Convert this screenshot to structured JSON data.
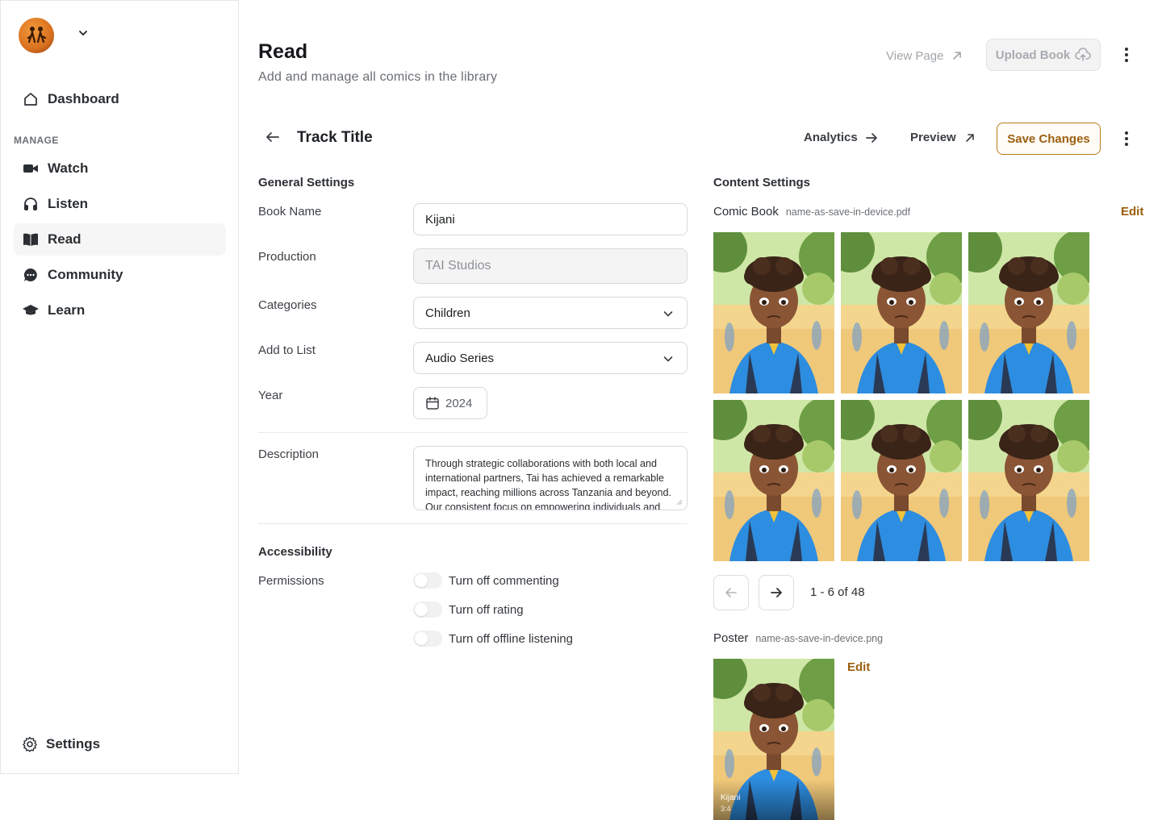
{
  "sidebar": {
    "manage_label": "MANAGE",
    "dashboard": {
      "label": "Dashboard",
      "icon": "home-icon"
    },
    "items": [
      {
        "label": "Watch",
        "icon": "video-camera-icon"
      },
      {
        "label": "Listen",
        "icon": "headphones-icon"
      },
      {
        "label": "Read",
        "icon": "book-open-icon",
        "active": true
      },
      {
        "label": "Community",
        "icon": "chat-bubble-icon"
      },
      {
        "label": "Learn",
        "icon": "graduation-cap-icon"
      }
    ],
    "settings": {
      "label": "Settings",
      "icon": "gear-icon"
    }
  },
  "header": {
    "title": "Read",
    "subtitle": "Add and manage all comics in the library",
    "view_page": "View Page",
    "upload_book": "Upload Book"
  },
  "subheader": {
    "title": "Track Title",
    "analytics": "Analytics",
    "preview": "Preview",
    "save": "Save Changes"
  },
  "general": {
    "section_title": "General Settings",
    "book_name": {
      "label": "Book Name",
      "value": "Kijani"
    },
    "production": {
      "label": "Production",
      "value": "TAI Studios"
    },
    "categories": {
      "label": "Categories",
      "value": "Children"
    },
    "add_to_list": {
      "label": "Add to List",
      "value": "Audio Series"
    },
    "year": {
      "label": "Year",
      "value": "2024"
    },
    "description": {
      "label": "Description",
      "value": "Through strategic collaborations with both local and international partners, Tai has achieved a remarkable impact, reaching millions across Tanzania and beyond. Our consistent focus on empowering individuals and"
    }
  },
  "accessibility": {
    "section_title": "Accessibility",
    "permissions_label": "Permissions",
    "toggles": [
      {
        "label": "Turn off commenting",
        "on": false
      },
      {
        "label": "Turn off rating",
        "on": false
      },
      {
        "label": "Turn off offline listening",
        "on": false
      }
    ]
  },
  "content": {
    "section_title": "Content Settings",
    "comic_book": {
      "label": "Comic Book",
      "filename": "name-as-save-in-device.pdf",
      "edit": "Edit"
    },
    "pagination": "1 - 6 of 48",
    "poster": {
      "label": "Poster",
      "filename": "name-as-save-in-device.png",
      "edit": "Edit",
      "caption_title": "Kijani",
      "caption_ratio": "3:4"
    }
  },
  "colors": {
    "accent": "#9a5f0e",
    "accent_border": "#b97a1e",
    "active_nav_bg": "#f6f6f6"
  }
}
